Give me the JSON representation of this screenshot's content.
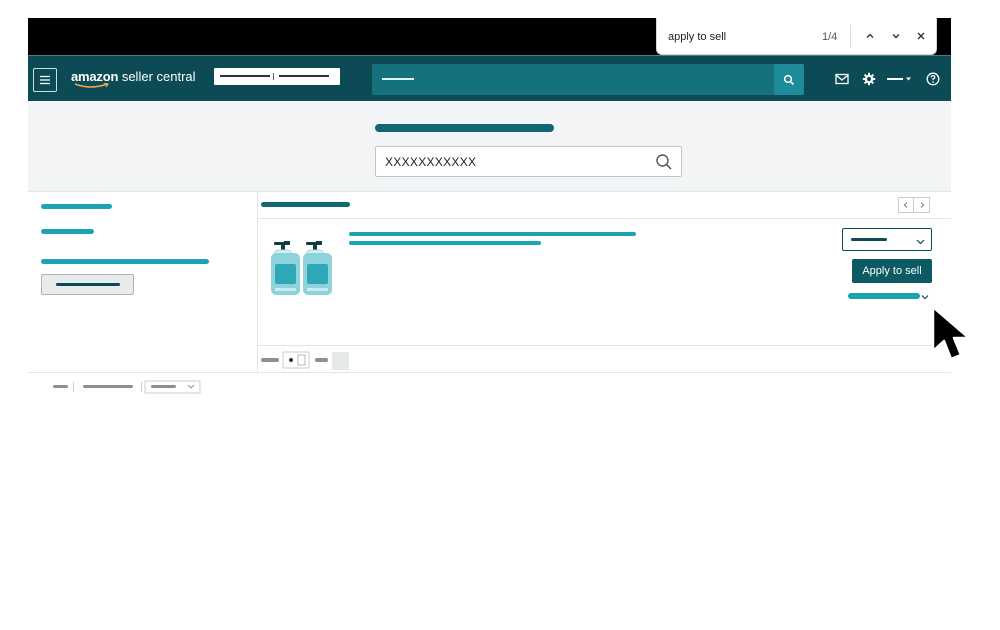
{
  "find_bar": {
    "query": "apply to sell",
    "match_count": "1/4",
    "icons": [
      "chevron-up-icon",
      "chevron-down-icon",
      "close-icon"
    ]
  },
  "header": {
    "logo_primary": "amazon",
    "logo_secondary": "seller central",
    "icons": [
      "menu-icon",
      "search-icon",
      "mail-icon",
      "gear-icon",
      "help-icon"
    ]
  },
  "hero": {
    "search_value": "XXXXXXXXXXX"
  },
  "product": {
    "button_label": "Apply to sell"
  },
  "colors": {
    "nav_bg": "#0c4b55",
    "accent": "#1aa3b3",
    "button_bg": "#0c5a63"
  }
}
